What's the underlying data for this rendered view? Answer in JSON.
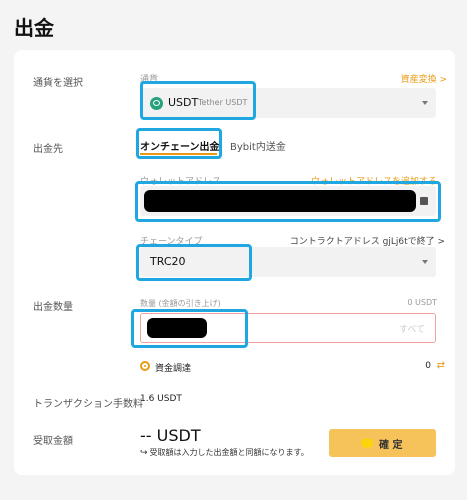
{
  "page": {
    "title": "出金"
  },
  "currency": {
    "label": "通貨を選択",
    "sub_label": "通貨",
    "convert_link": "資産変換 >",
    "symbol": "USDT",
    "name": "Tether USDT"
  },
  "destination": {
    "label": "出金先",
    "tabs": [
      {
        "label": "オンチェーン出金",
        "active": true
      },
      {
        "label": "Bybit内送金",
        "active": false
      }
    ],
    "wallet_label": "ウォレットアドレス",
    "add_wallet_link": "ウォレットアドレスを追加する",
    "chain_label": "チェーンタイプ",
    "contract_info": "コントラクトアドレス gjLj6tで終了 >",
    "chain_value": "TRC20"
  },
  "amount": {
    "label": "出金数量",
    "sub_label": "数量 (金額の引き上げ)",
    "available": "0 USDT",
    "all_button": "すべて",
    "funding_label": "資金調達",
    "funding_value": "0"
  },
  "fee": {
    "label": "トランザクション手数料",
    "value": "1.6 USDT"
  },
  "receive": {
    "label": "受取金額",
    "value": "-- USDT",
    "note": "受取額は入力した出金額と同額になります。",
    "confirm_button": "確 定"
  },
  "colors": {
    "accent": "#e89b14",
    "confirm_bg": "#f6c35a",
    "highlight": "#1ea7e1"
  }
}
